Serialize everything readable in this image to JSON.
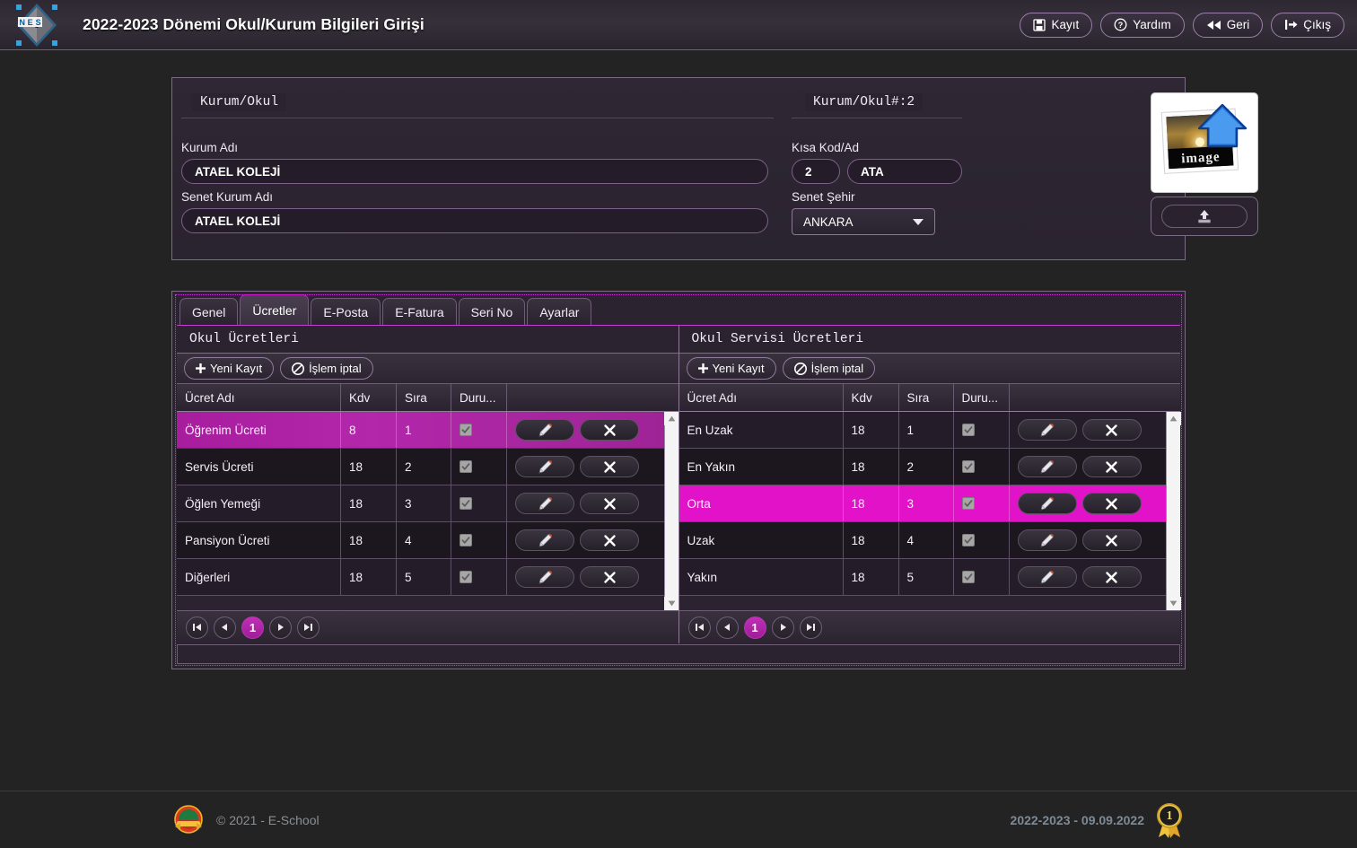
{
  "header": {
    "logo_alt": "nes-logo",
    "title": "2022-2023 Dönemi Okul/Kurum Bilgileri Girişi",
    "buttons": [
      {
        "id": "save",
        "label": "Kayıt",
        "icon": "floppy-disk-icon"
      },
      {
        "id": "help",
        "label": "Yardım",
        "icon": "question-circle-icon"
      },
      {
        "id": "back",
        "label": "Geri",
        "icon": "rewind-icon"
      },
      {
        "id": "exit",
        "label": "Çıkış",
        "icon": "logout-icon"
      }
    ]
  },
  "info_panel": {
    "legend_left": "Kurum/Okul",
    "legend_right": "Kurum/Okul#:2",
    "fields": {
      "kurum_adi_label": "Kurum Adı",
      "kurum_adi_value": "ATAEL KOLEJİ",
      "senet_kurum_adi_label": "Senet Kurum Adı",
      "senet_kurum_adi_value": "ATAEL KOLEJİ",
      "kisa_kod_label": "Kısa Kod/Ad",
      "kisa_kod_value": "2",
      "kisa_ad_value": "ATA",
      "senet_sehir_label": "Senet Şehir",
      "senet_sehir_value": "ANKARA"
    },
    "image_placeholder_text": "image",
    "upload_icon": "upload-icon"
  },
  "tabs": [
    {
      "id": "genel",
      "label": "Genel",
      "active": false
    },
    {
      "id": "ucretler",
      "label": "Ücretler",
      "active": true
    },
    {
      "id": "eposta",
      "label": "E-Posta",
      "active": false
    },
    {
      "id": "efatura",
      "label": "E-Fatura",
      "active": false
    },
    {
      "id": "serino",
      "label": "Seri No",
      "active": false
    },
    {
      "id": "ayarlar",
      "label": "Ayarlar",
      "active": false
    }
  ],
  "toolbar": {
    "new_label": "Yeni Kayıt",
    "new_icon": "plus-icon",
    "cancel_label": "İşlem iptal",
    "cancel_icon": "no-entry-icon"
  },
  "columns": [
    "Ücret Adı",
    "Kdv",
    "Sıra",
    "Duru..."
  ],
  "row_actions": {
    "edit_icon": "pencil-icon",
    "delete_icon": "close-x-icon"
  },
  "grids": [
    {
      "id": "okul-ucretleri",
      "title": "Okul Ücretleri",
      "selection_style": "gradient",
      "rows": [
        {
          "name": "Öğrenim Ücreti",
          "kdv": "8",
          "sira": "1",
          "durum": true,
          "selected": true
        },
        {
          "name": "Servis Ücreti",
          "kdv": "18",
          "sira": "2",
          "durum": true,
          "selected": false
        },
        {
          "name": "Öğlen Yemeği",
          "kdv": "18",
          "sira": "3",
          "durum": true,
          "selected": false
        },
        {
          "name": "Pansiyon Ücreti",
          "kdv": "18",
          "sira": "4",
          "durum": true,
          "selected": false
        },
        {
          "name": "Diğerleri",
          "kdv": "18",
          "sira": "5",
          "durum": true,
          "selected": false
        }
      ],
      "pager": {
        "first": "⏮",
        "prev": "◀",
        "current": "1",
        "next": "▶",
        "last": "⏭"
      }
    },
    {
      "id": "okul-servisi-ucretleri",
      "title": "Okul Servisi Ücretleri",
      "selection_style": "bright",
      "rows": [
        {
          "name": "En Uzak",
          "kdv": "18",
          "sira": "1",
          "durum": true,
          "selected": false
        },
        {
          "name": "En Yakın",
          "kdv": "18",
          "sira": "2",
          "durum": true,
          "selected": false
        },
        {
          "name": "Orta",
          "kdv": "18",
          "sira": "3",
          "durum": true,
          "selected": true
        },
        {
          "name": "Uzak",
          "kdv": "18",
          "sira": "4",
          "durum": true,
          "selected": false
        },
        {
          "name": "Yakın",
          "kdv": "18",
          "sira": "5",
          "durum": true,
          "selected": false
        }
      ],
      "pager": {
        "first": "⏮",
        "prev": "◀",
        "current": "1",
        "next": "▶",
        "last": "⏭"
      }
    }
  ],
  "footer": {
    "copyright": "© 2021 - E-School",
    "date_info": "2022-2023 - 09.09.2022",
    "badge_icon": "award-ribbon-icon",
    "logo_icon": "school-seal-icon"
  },
  "colors": {
    "accent_magenta": "#e212c8",
    "accent_purple": "#b327ab",
    "panel_bg": "#2b2430",
    "page_bg": "#232323",
    "border": "#7b6c84"
  }
}
